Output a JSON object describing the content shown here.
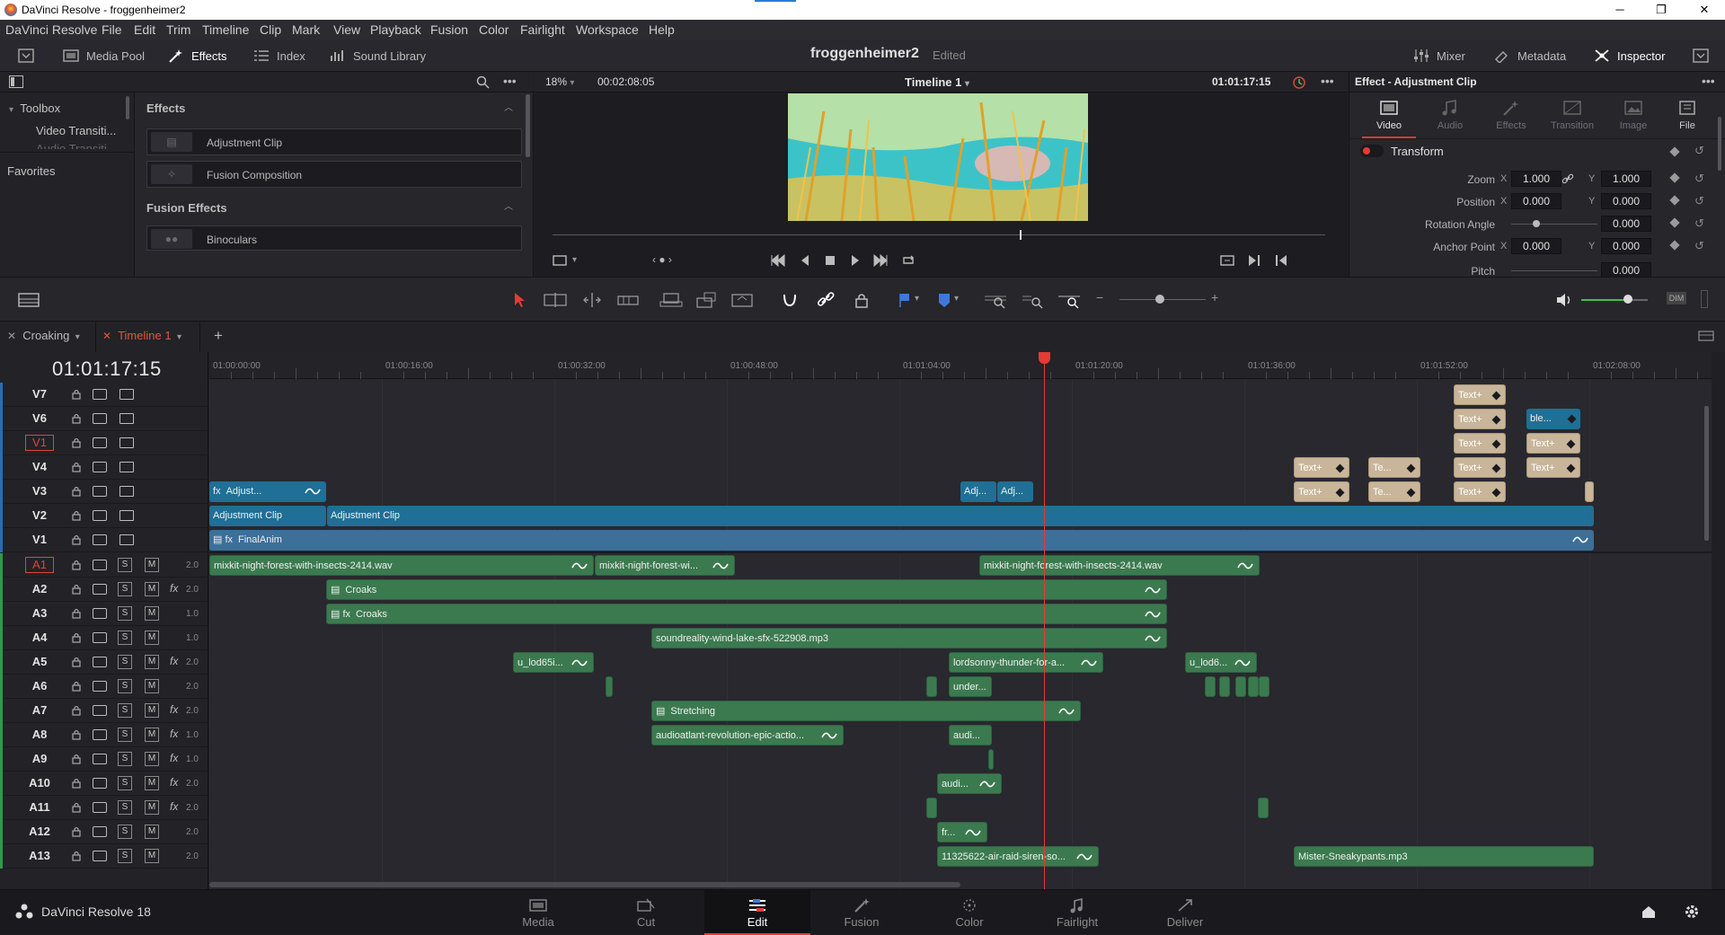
{
  "window": {
    "title": "DaVinci Resolve - froggenheimer2",
    "minimize": "─",
    "maximize": "❐",
    "close": "✕"
  },
  "menu": [
    "DaVinci Resolve",
    "File",
    "Edit",
    "Trim",
    "Timeline",
    "Clip",
    "Mark",
    "View",
    "Playback",
    "Fusion",
    "Color",
    "Fairlight",
    "Workspace",
    "Help"
  ],
  "toolbar": {
    "media_pool": "Media Pool",
    "effects": "Effects",
    "index": "Index",
    "sound_library": "Sound Library",
    "project_title": "froggenheimer2",
    "project_state": "Edited",
    "mixer": "Mixer",
    "metadata": "Metadata",
    "inspector": "Inspector"
  },
  "effects_panel": {
    "tree": {
      "toolbox": "Toolbox",
      "video_transitions": "Video Transiti...",
      "audio_transitions": "Audio Transiti...",
      "favorites": "Favorites"
    },
    "effects_section": "Effects",
    "items": [
      {
        "label": "Adjustment Clip"
      },
      {
        "label": "Fusion Composition"
      }
    ],
    "fusion_section": "Fusion Effects",
    "fusion_items": [
      {
        "label": "Binoculars"
      }
    ]
  },
  "viewer": {
    "zoom": "18%",
    "duration": "00:02:08:05",
    "timeline_name": "Timeline 1",
    "timecode": "01:01:17:15"
  },
  "inspector": {
    "title": "Effect - Adjustment Clip",
    "tabs": [
      "Video",
      "Audio",
      "Effects",
      "Transition",
      "Image",
      "File"
    ],
    "section": "Transform",
    "rows": [
      {
        "label": "Zoom",
        "x": "1.000",
        "y": "1.000"
      },
      {
        "label": "Position",
        "x": "0.000",
        "y": "0.000"
      },
      {
        "label": "Rotation Angle",
        "v": "0.000"
      },
      {
        "label": "Anchor Point",
        "x": "0.000",
        "y": "0.000"
      },
      {
        "label": "Pitch",
        "v": "0.000"
      }
    ],
    "x_label": "X",
    "y_label": "Y"
  },
  "timeline_tabs": [
    {
      "label": "Croaking"
    },
    {
      "label": "Timeline 1"
    }
  ],
  "timeline": {
    "timecode": "01:01:17:15",
    "ruler": [
      "01:00:00:00",
      "01:00:16:00",
      "01:00:32:00",
      "01:00:48:00",
      "01:01:04:00",
      "01:01:20:00",
      "01:01:36:00",
      "01:01:52:00",
      "01:02:08:00"
    ],
    "video_tracks": [
      "V7",
      "V6",
      "V1",
      "V4",
      "V3",
      "V2",
      "V1"
    ],
    "audio_tracks": [
      {
        "name": "A1",
        "vol": "2.0",
        "fx": false
      },
      {
        "name": "A2",
        "vol": "2.0",
        "fx": true
      },
      {
        "name": "A3",
        "vol": "1.0",
        "fx": false
      },
      {
        "name": "A4",
        "vol": "1.0",
        "fx": false
      },
      {
        "name": "A5",
        "vol": "2.0",
        "fx": true
      },
      {
        "name": "A6",
        "vol": "2.0",
        "fx": false
      },
      {
        "name": "A7",
        "vol": "2.0",
        "fx": true
      },
      {
        "name": "A8",
        "vol": "1.0",
        "fx": true
      },
      {
        "name": "A9",
        "vol": "1.0",
        "fx": true
      },
      {
        "name": "A10",
        "vol": "2.0",
        "fx": true
      },
      {
        "name": "A11",
        "vol": "2.0",
        "fx": true
      },
      {
        "name": "A12",
        "vol": "2.0",
        "fx": false
      },
      {
        "name": "A13",
        "vol": "2.0",
        "fx": false
      }
    ],
    "s_label": "S",
    "m_label": "M",
    "fx_label": "fx",
    "clips": {
      "adjust_v3": "Adjust...",
      "adj1": "Adj...",
      "adj2": "Adj...",
      "adjclip1": "Adjustment Clip",
      "adjclip2": "Adjustment Clip",
      "finalanim": "FinalAnim",
      "text": "Text+",
      "te": "Te...",
      "ble": "ble...",
      "a1_1": "mixkit-night-forest-with-insects-2414.wav",
      "a1_2": "mixkit-night-forest-wi...",
      "a1_3": "mixkit-night-forest-with-insects-2414.wav",
      "croaks1": "Croaks",
      "croaks2": "Croaks",
      "sound": "soundreality-wind-lake-sfx-522908.mp3",
      "ulod1": "u_lod65i...",
      "lordsonny": "lordsonny-thunder-for-a...",
      "ulod2": "u_lod6...",
      "under": "under...",
      "stretching": "Stretching",
      "audioatlant": "audioatlant-revolution-epic-actio...",
      "audi1": "audi...",
      "audi2": "audi...",
      "fr": "fr...",
      "siren": "11325622-air-raid-siren-so...",
      "mister": "Mister-Sneakypants.mp3"
    }
  },
  "pages": [
    "Media",
    "Cut",
    "Edit",
    "Fusion",
    "Color",
    "Fairlight",
    "Deliver"
  ],
  "brand": "DaVinci Resolve 18",
  "colors": {
    "accent_red": "#e53b35",
    "video_clip": "#1f6f96",
    "audio_clip": "#3b7a4f",
    "text_clip": "#c9b59a"
  }
}
